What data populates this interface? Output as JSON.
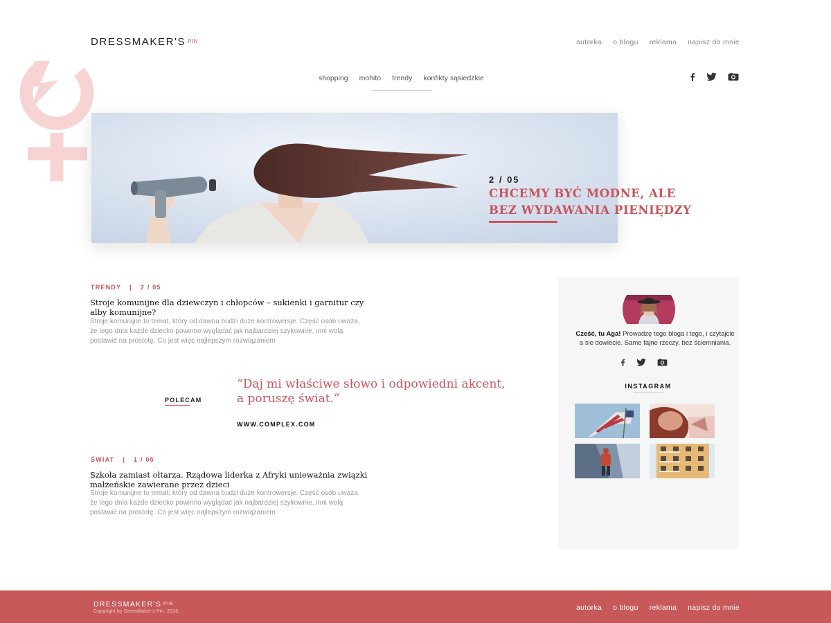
{
  "brand": {
    "name": "DRESSMAKER'S",
    "suffix": "PIN"
  },
  "top_nav": [
    {
      "label": "autorka"
    },
    {
      "label": "o blogu"
    },
    {
      "label": "reklama"
    },
    {
      "label": "napisz do mnie"
    }
  ],
  "category_nav": [
    {
      "label": "shopping"
    },
    {
      "label": "mohito"
    },
    {
      "label": "trendy"
    },
    {
      "label": "konfikty sąsiedzkie"
    }
  ],
  "social_icons": [
    "facebook-icon",
    "twitter-icon",
    "instagram-icon"
  ],
  "hero": {
    "counter": "2 / 05",
    "title_line1": "CHCEMY BYĆ MODNE, ALE",
    "title_line2": "BEZ WYDAWANIA PIENIĘDZY"
  },
  "posts": [
    {
      "category": "TRENDY",
      "sep": "|",
      "counter": "2 / 05",
      "title": "Stroje komunijne dla dziewczyn i chłopców – sukienki i garnitur czy alby komunijne?",
      "excerpt": "Stroje komunijne to temat, który od dawna budzi duże kontrowersje. Część osób uważa, że tego dnia każde dziecko powinno wyglądać jak najbardziej szykownie, inni wolą postawić na prostotę. Co jest więc najlepszym rozwiązaniem"
    },
    {
      "category": "ŚWIAT",
      "sep": "|",
      "counter": "1 / 05",
      "title": "Szkoła zamiast ołtarza. Rządowa liderka z Afryki unieważnia związki małżeńskie zawierane przez dzieci",
      "excerpt": "Stroje komunijne to temat, który od dawna budzi duże kontrowersje. Część osób uważa, że tego dnia każde dziecko powinno wyglądać jak najbardziej szykownie, inni wolą postawić na prostotę. Co jest więc najlepszym rozwiązaniem"
    }
  ],
  "recommend": {
    "label": "POLECAM",
    "quote": "“Daj mi właściwe słowo i odpowiedni akcent, a poruszę świat.”",
    "source": "WWW.COMPLEX.COM"
  },
  "sidebar": {
    "greeting": "Cześć, tu Aga!",
    "about": " Prowadzę tego bloga i tego, i czytajcie a sie dowiecie. Same fajne rzeczy, bez ściemniania.",
    "instagram_heading": "INSTAGRAM"
  },
  "footer": {
    "brand": "DRESSMAKER'S",
    "suffix": "PIN",
    "copyright": "Copyright by DressMaker's Pin. 2016.",
    "nav": [
      {
        "label": "autorka"
      },
      {
        "label": "o blogu"
      },
      {
        "label": "reklama"
      },
      {
        "label": "napisz do mnie"
      }
    ]
  },
  "colors": {
    "accent": "#c8555b",
    "footer_bg": "#c8595b",
    "sidebar_bg": "#f6f6f6"
  }
}
